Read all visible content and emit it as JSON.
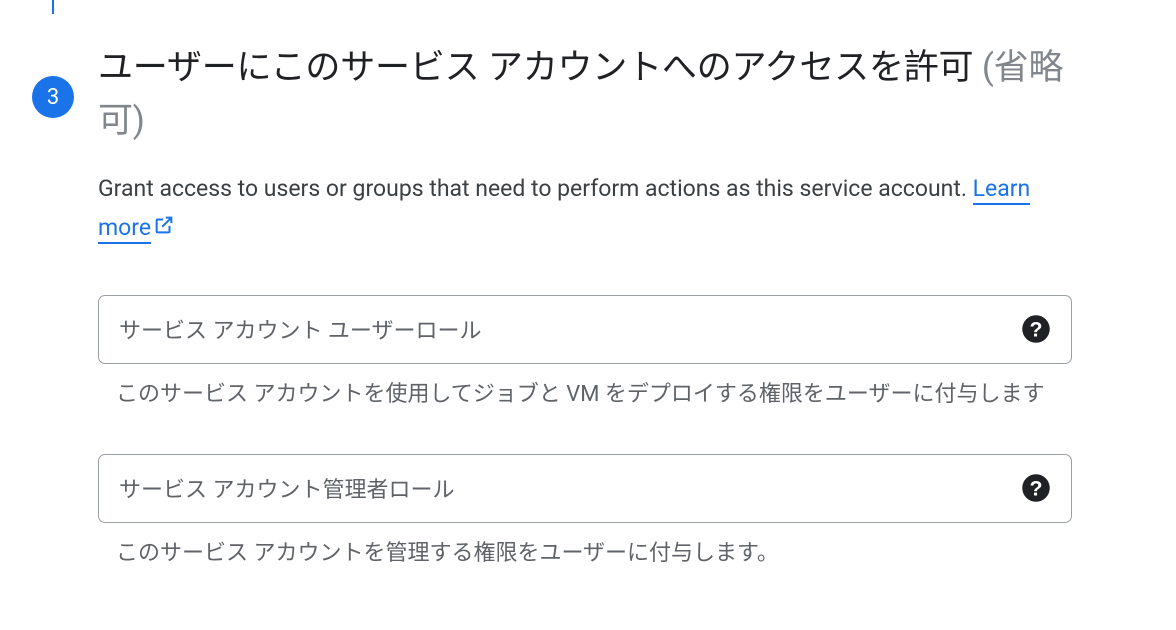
{
  "step": {
    "number": "3",
    "title_main": "ユーザーにこのサービス アカウントへのアクセスを許可 ",
    "title_optional": "(省略可)",
    "description_prefix": "Grant access to users or groups that need to perform actions as this service account. ",
    "learn_more": "Learn more"
  },
  "fields": [
    {
      "label": "サービス アカウント ユーザーロール",
      "helper": "このサービス アカウントを使用してジョブと VM をデプロイする権限をユーザーに付与します"
    },
    {
      "label": "サービス アカウント管理者ロール",
      "helper": "このサービス アカウントを管理する権限をユーザーに付与します。"
    }
  ]
}
